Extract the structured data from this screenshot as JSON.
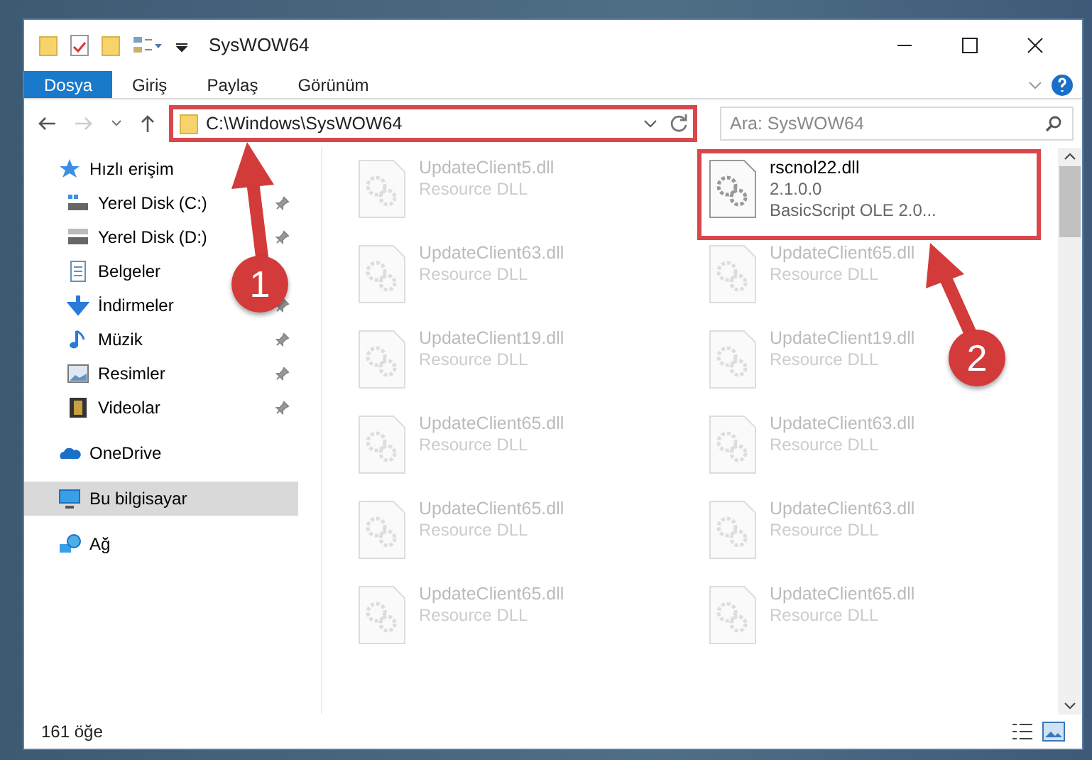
{
  "window": {
    "title": "SysWOW64"
  },
  "ribbon_tabs": [
    {
      "label": "Dosya",
      "selected": true
    },
    {
      "label": "Giriş",
      "selected": false
    },
    {
      "label": "Paylaş",
      "selected": false
    },
    {
      "label": "Görünüm",
      "selected": false
    }
  ],
  "address": {
    "path": "C:\\Windows\\SysWOW64"
  },
  "search": {
    "placeholder": "Ara: SysWOW64"
  },
  "sidebar": {
    "items": [
      {
        "label": "Hızlı erişim",
        "pinned": false,
        "selected": false,
        "children": [
          {
            "label": "Yerel Disk (C:)",
            "pinned": true,
            "selected": false
          },
          {
            "label": "Yerel Disk (D:)",
            "pinned": true,
            "selected": false
          },
          {
            "label": "Belgeler",
            "pinned": false,
            "selected": false
          },
          {
            "label": "İndirmeler",
            "pinned": true,
            "selected": false
          },
          {
            "label": "Müzik",
            "pinned": true,
            "selected": false
          },
          {
            "label": "Resimler",
            "pinned": true,
            "selected": false
          },
          {
            "label": "Videolar",
            "pinned": true,
            "selected": false
          }
        ]
      },
      {
        "label": "OneDrive",
        "pinned": false,
        "selected": false
      },
      {
        "label": "Bu bilgisayar",
        "pinned": false,
        "selected": true
      },
      {
        "label": "Ağ",
        "pinned": false,
        "selected": false
      }
    ]
  },
  "files": [
    {
      "name": "UpdateClient5.dll",
      "lines": [
        "Resource DLL"
      ],
      "faded": true,
      "highlighted": false
    },
    {
      "name": "rscnol22.dll",
      "lines": [
        "2.1.0.0",
        "BasicScript OLE 2.0..."
      ],
      "faded": false,
      "highlighted": true
    },
    {
      "name": "UpdateClient63.dll",
      "lines": [
        "Resource DLL"
      ],
      "faded": true,
      "highlighted": false
    },
    {
      "name": "UpdateClient65.dll",
      "lines": [
        "Resource DLL"
      ],
      "faded": true,
      "highlighted": false
    },
    {
      "name": "UpdateClient19.dll",
      "lines": [
        "Resource DLL"
      ],
      "faded": true,
      "highlighted": false
    },
    {
      "name": "UpdateClient19.dll",
      "lines": [
        "Resource DLL"
      ],
      "faded": true,
      "highlighted": false
    },
    {
      "name": "UpdateClient65.dll",
      "lines": [
        "Resource DLL"
      ],
      "faded": true,
      "highlighted": false
    },
    {
      "name": "UpdateClient63.dll",
      "lines": [
        "Resource DLL"
      ],
      "faded": true,
      "highlighted": false
    },
    {
      "name": "UpdateClient65.dll",
      "lines": [
        "Resource DLL"
      ],
      "faded": true,
      "highlighted": false
    },
    {
      "name": "UpdateClient63.dll",
      "lines": [
        "Resource DLL"
      ],
      "faded": true,
      "highlighted": false
    },
    {
      "name": "UpdateClient65.dll",
      "lines": [
        "Resource DLL"
      ],
      "faded": true,
      "highlighted": false
    },
    {
      "name": "UpdateClient65.dll",
      "lines": [
        "Resource DLL"
      ],
      "faded": true,
      "highlighted": false
    }
  ],
  "status_bar": {
    "count": "161 öğe"
  },
  "annotations": [
    {
      "number": "1"
    },
    {
      "number": "2"
    }
  ]
}
